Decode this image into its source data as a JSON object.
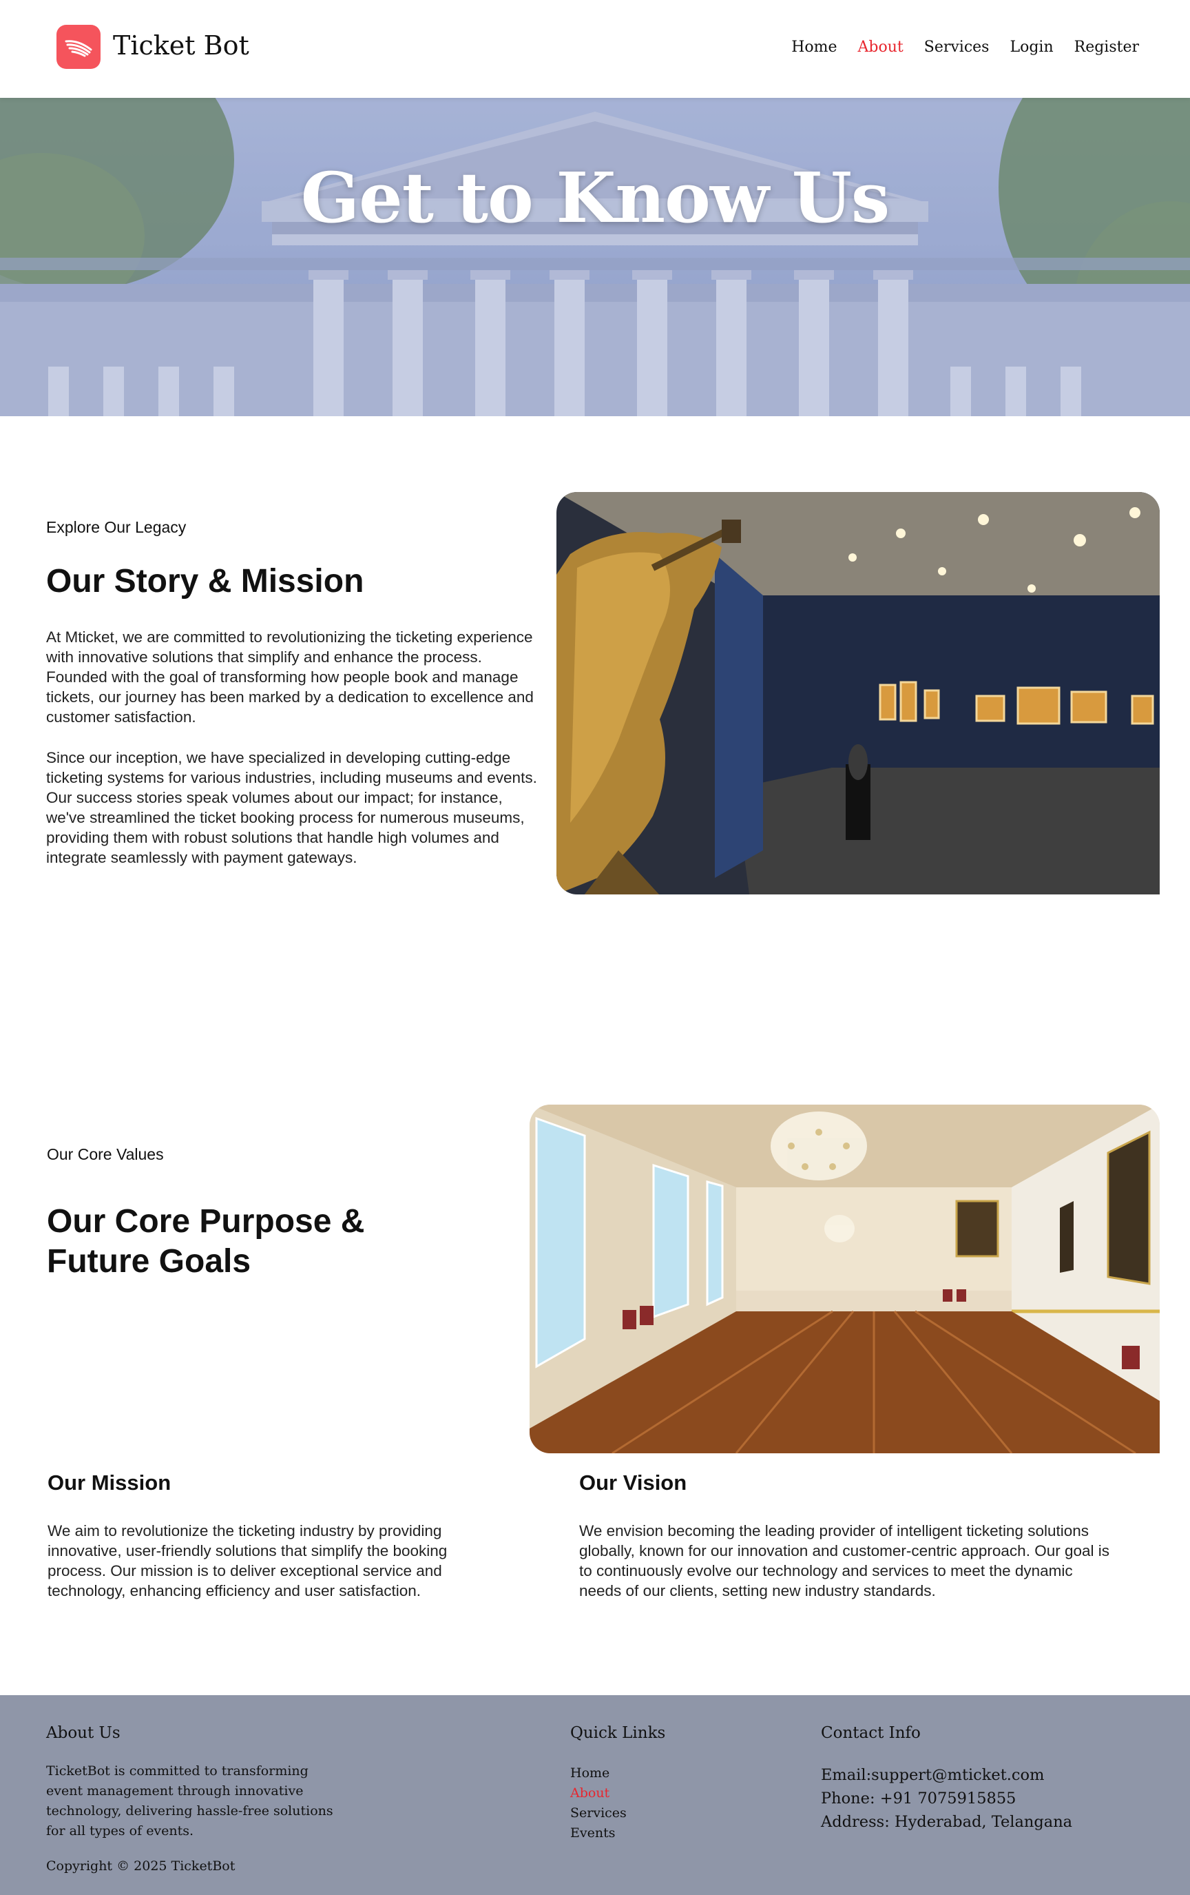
{
  "header": {
    "brand": "Ticket Bot",
    "nav": [
      "Home",
      "About",
      "Services",
      "Login",
      "Register"
    ],
    "active_nav": "About",
    "accent_color": "#e8262e",
    "logo_color": "#f5545c"
  },
  "hero": {
    "title": "Get to Know Us"
  },
  "story": {
    "eyebrow": "Explore Our Legacy",
    "title": "Our Story & Mission",
    "paragraphs": [
      "At Mticket, we are committed to revolutionizing the ticketing experience with innovative solutions that simplify and enhance the process. Founded with the goal of transforming how people book and manage tickets, our journey has been marked by a dedication to excellence and customer satisfaction.",
      "Since our inception, we have specialized in developing cutting-edge ticketing systems for various industries, including museums and events. Our success stories speak volumes about our impact; for instance, we've streamlined the ticket booking process for numerous museums, providing them with robust solutions that handle high volumes and integrate seamlessly with payment gateways."
    ]
  },
  "values": {
    "eyebrow": "Our Core Values",
    "title_lines": [
      "Our Core Purpose &",
      "Future Goals"
    ],
    "mission": {
      "title": "Our Mission",
      "text": "We aim to revolutionize the ticketing industry by providing innovative, user-friendly solutions that simplify the booking process. Our mission is to deliver exceptional service and technology, enhancing efficiency and user satisfaction."
    },
    "vision": {
      "title": "Our Vision",
      "text": "We envision becoming the leading provider of intelligent ticketing solutions globally, known for our innovation and customer-centric approach. Our goal is to continuously evolve our technology and services to meet the dynamic needs of our clients, setting new industry standards."
    }
  },
  "footer": {
    "about_title": "About Us",
    "about_text": "TicketBot is committed to transforming event management through innovative technology, delivering hassle-free solutions for all types of events.",
    "copyright": "Copyright © 2025 TicketBot",
    "links_title": "Quick Links",
    "links": [
      "Home",
      "About",
      "Services",
      "Events"
    ],
    "active_link": "About",
    "contact_title": "Contact Info",
    "email": "Email:suppert@mticket.com",
    "phone": "Phone: +91 7075915855",
    "address": "Address: Hyderabad, Telangana"
  }
}
